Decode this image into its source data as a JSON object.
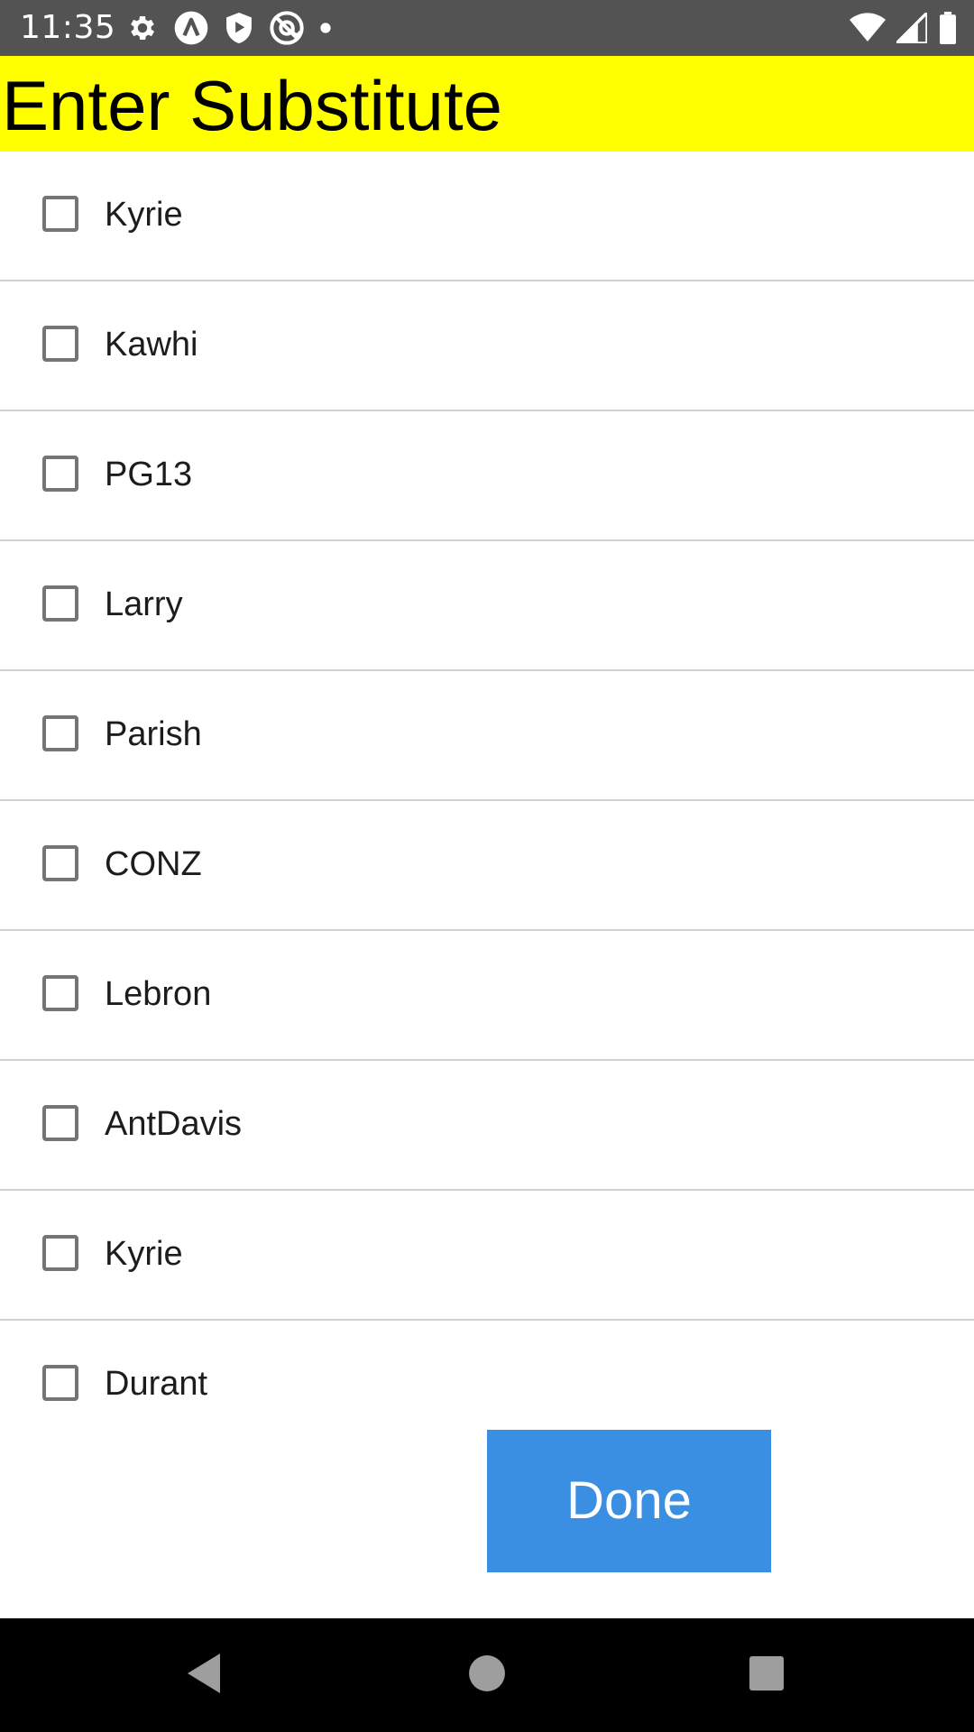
{
  "status_bar": {
    "time": "11:35",
    "left_icons": [
      "gear-icon",
      "a-circle-icon",
      "play-shield-icon",
      "at-circle-icon",
      "dot-icon"
    ],
    "right_icons": [
      "wifi-icon",
      "cell-signal-icon",
      "battery-icon"
    ]
  },
  "header": {
    "title": "Enter Substitute",
    "background": "#ffff00"
  },
  "players": [
    {
      "label": "Kyrie",
      "checked": false
    },
    {
      "label": "Kawhi",
      "checked": false
    },
    {
      "label": "PG13",
      "checked": false
    },
    {
      "label": "Larry",
      "checked": false
    },
    {
      "label": "Parish",
      "checked": false
    },
    {
      "label": "CONZ",
      "checked": false
    },
    {
      "label": "Lebron",
      "checked": false
    },
    {
      "label": "AntDavis",
      "checked": false
    },
    {
      "label": "Kyrie",
      "checked": false
    },
    {
      "label": "Durant",
      "checked": false
    }
  ],
  "done_button": {
    "label": "Done",
    "color": "#3a8fe3"
  },
  "nav_bar": {
    "icons": [
      "back-icon",
      "home-icon",
      "recents-icon"
    ]
  }
}
